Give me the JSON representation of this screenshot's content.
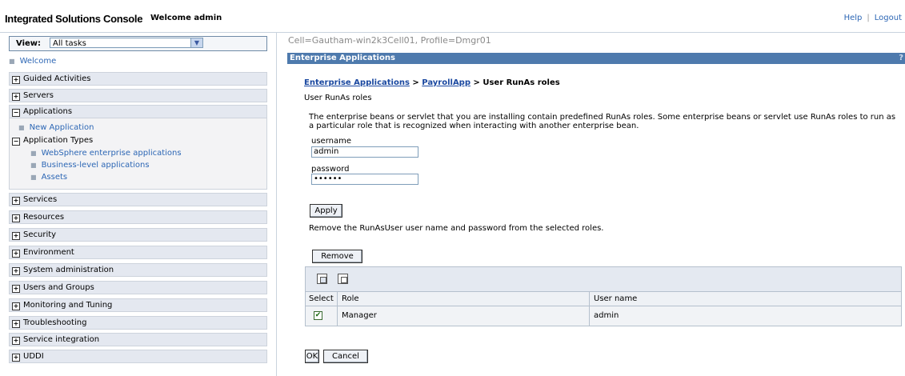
{
  "header": {
    "app_title": "Integrated Solutions Console",
    "welcome": "Welcome admin",
    "help": "Help",
    "separator": "|",
    "logout": "Logout"
  },
  "nav": {
    "view_label": "View:",
    "view_value": "All tasks",
    "welcome": "Welcome",
    "sections": {
      "guided": "Guided Activities",
      "servers": "Servers",
      "applications": "Applications",
      "services": "Services",
      "resources": "Resources",
      "security": "Security",
      "environment": "Environment",
      "sysadmin": "System administration",
      "users": "Users and Groups",
      "monitoring": "Monitoring and Tuning",
      "troubleshooting": "Troubleshooting",
      "service_integration": "Service integration",
      "uddi": "UDDI"
    },
    "apps": {
      "new_application": "New Application",
      "application_types": "Application Types",
      "websphere_apps": "WebSphere enterprise applications",
      "business_level": "Business-level applications",
      "assets": "Assets"
    }
  },
  "main": {
    "cell_profile": "Cell=Gautham-win2k3Cell01, Profile=Dmgr01",
    "panel_title": "Enterprise Applications",
    "panel_help": "?",
    "breadcrumb": {
      "link1": "Enterprise Applications",
      "sep1": " > ",
      "link2": "PayrollApp",
      "sep2": " > ",
      "current": "User RunAs roles"
    },
    "subtitle": "User RunAs roles",
    "description": "The enterprise beans or servlet that you are installing contain predefined RunAs roles. Some enterprise beans or servlet use RunAs roles to run as a particular role that is recognized when interacting with another enterprise bean.",
    "username_label": "username",
    "username_value": "admin",
    "password_label": "password",
    "password_value": "••••••",
    "apply": "Apply",
    "remove_description": "Remove the RunAsUser user name and password from the selected roles.",
    "remove": "Remove",
    "table": {
      "headers": [
        "Select",
        "Role",
        "User name"
      ],
      "rows": [
        {
          "selected": true,
          "check": "✔",
          "role": "Manager",
          "user": "admin"
        }
      ]
    },
    "ok": "OK",
    "cancel": "Cancel"
  }
}
